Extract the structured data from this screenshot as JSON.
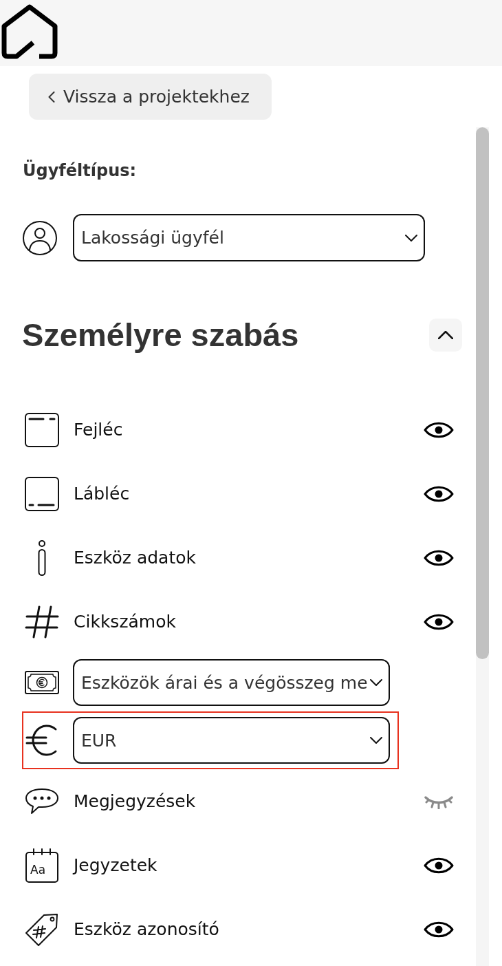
{
  "back_button": {
    "label": "Vissza a projektekhez"
  },
  "customer_type": {
    "label": "Ügyféltípus:",
    "value": "Lakossági ügyfél"
  },
  "section": {
    "title": "Személyre szabás",
    "expanded": true,
    "items": [
      {
        "kind": "toggle",
        "label": "Fejléc",
        "visible": true
      },
      {
        "kind": "toggle",
        "label": "Lábléc",
        "visible": true
      },
      {
        "kind": "toggle",
        "label": "Eszköz adatok",
        "visible": true
      },
      {
        "kind": "toggle",
        "label": "Cikkszámok",
        "visible": true
      },
      {
        "kind": "select",
        "value": "Eszközök árai és a végösszeg me"
      },
      {
        "kind": "select",
        "value": "EUR",
        "highlighted": true
      },
      {
        "kind": "toggle",
        "label": "Megjegyzések",
        "visible": false
      },
      {
        "kind": "toggle",
        "label": "Jegyzetek",
        "icon_text": "Aa",
        "visible": true
      },
      {
        "kind": "toggle",
        "label": "Eszköz azonosító",
        "visible": true
      }
    ]
  }
}
